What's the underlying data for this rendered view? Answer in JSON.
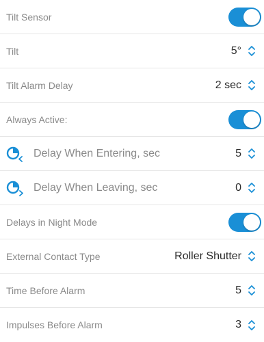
{
  "accent_color": "#1a8fd6",
  "rows": [
    {
      "label": "Tilt Sensor",
      "control": "toggle",
      "on": true
    },
    {
      "label": "Tilt",
      "value": "5°",
      "control": "stepper"
    },
    {
      "label": "Tilt Alarm Delay",
      "value": "2 sec",
      "control": "stepper"
    },
    {
      "label": "Always Active:",
      "control": "toggle",
      "on": true
    },
    {
      "label": "Delay When Entering, sec",
      "value": "5",
      "control": "stepper",
      "icon": "clock-entering-icon"
    },
    {
      "label": "Delay When Leaving, sec",
      "value": "0",
      "control": "stepper",
      "icon": "clock-leaving-icon"
    },
    {
      "label": "Delays in Night Mode",
      "control": "toggle",
      "on": true
    },
    {
      "label": "External Contact Type",
      "value": "Roller Shutter",
      "control": "stepper"
    },
    {
      "label": "Time Before Alarm",
      "value": "5",
      "control": "stepper"
    },
    {
      "label": "Impulses Before Alarm",
      "value": "3",
      "control": "stepper"
    }
  ]
}
